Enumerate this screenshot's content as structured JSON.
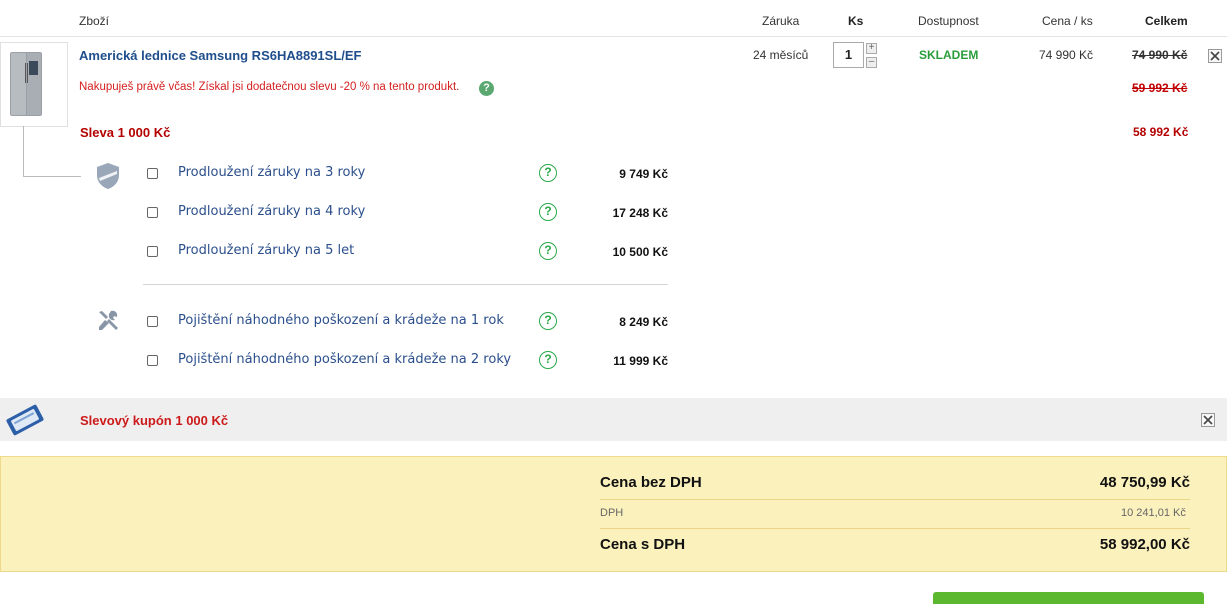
{
  "table_header": {
    "product": "Zboží",
    "warranty": "Záruka",
    "qty": "Ks",
    "availability": "Dostupnost",
    "unit_price": "Cena / ks",
    "total": "Celkem"
  },
  "product": {
    "title": "Americká lednice Samsung RS6HA8891SL/EF",
    "warranty": "24 měsíců",
    "qty": "1",
    "availability": "SKLADEM",
    "unit_price": "74 990 Kč",
    "total_original": "74 990 Kč",
    "promo_text": "Nakupuješ právě včas! Získal jsi dodatečnou slevu -20 % na tento produkt.",
    "promo_price": "59 992 Kč",
    "discount_label": "Sleva 1 000 Kč",
    "final_price": "58 992 Kč"
  },
  "warranty_options": [
    {
      "label": "Prodloužení záruky na 3 roky",
      "price": "9 749 Kč"
    },
    {
      "label": "Prodloužení záruky na 4 roky",
      "price": "17 248 Kč"
    },
    {
      "label": "Prodloužení záruky na 5 let",
      "price": "10 500 Kč"
    }
  ],
  "insurance_options": [
    {
      "label": "Pojištění náhodného poškození a krádeže na 1 rok",
      "price": "8 249 Kč"
    },
    {
      "label": "Pojištění náhodného poškození a krádeže na 2 roky",
      "price": "11 999 Kč"
    }
  ],
  "coupon": {
    "label": "Slevový kupón 1 000 Kč"
  },
  "summary": {
    "without_vat_label": "Cena bez DPH",
    "without_vat_value": "48 750,99 Kč",
    "vat_label": "DPH",
    "vat_value": "10 241,01 Kč",
    "with_vat_label": "Cena s DPH",
    "with_vat_value": "58 992,00 Kč"
  },
  "colors": {
    "link_blue": "#1f4e8c",
    "stock_green": "#2a9d3b",
    "discount_red": "#b30000",
    "summary_bg": "#fbf1bd",
    "cta_green": "#5cb92f"
  }
}
